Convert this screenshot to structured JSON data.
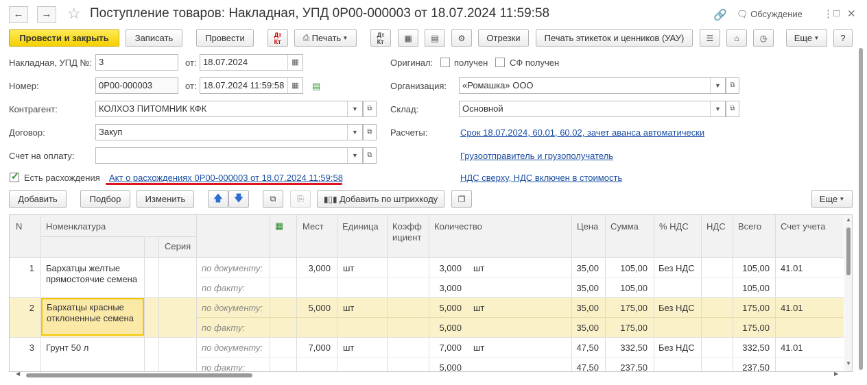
{
  "window": {
    "title": "Поступление товаров: Накладная, УПД 0Р00-000003 от 18.07.2024 11:59:58",
    "discuss_label": "Обсуждение"
  },
  "toolbar": {
    "post_close": "Провести и закрыть",
    "save": "Записать",
    "post": "Провести",
    "print": "Печать",
    "segments": "Отрезки",
    "print_labels": "Печать этикеток и ценников (УАУ)",
    "more": "Еще",
    "help": "?"
  },
  "form": {
    "invoice_label": "Накладная, УПД №:",
    "invoice_value": "3",
    "from_label": "от:",
    "invoice_date": "18.07.2024",
    "number_label": "Номер:",
    "number_value": "0Р00-000003",
    "number_from_label": "от:",
    "number_date": "18.07.2024 11:59:58",
    "counterparty_label": "Контрагент:",
    "counterparty_value": "КОЛХОЗ ПИТОМНИК КФК",
    "contract_label": "Договор:",
    "contract_value": "Закуп",
    "payment_invoice_label": "Счет на оплату:",
    "payment_invoice_value": "",
    "original_label": "Оригинал:",
    "received_label": "получен",
    "sf_received_label": "СФ получен",
    "organization_label": "Организация:",
    "organization_value": "«Ромашка» ООО",
    "warehouse_label": "Склад:",
    "warehouse_value": "Основной",
    "settlements_label": "Расчеты:",
    "settlements_link": "Срок 18.07.2024, 60.01, 60.02, зачет аванса автоматически",
    "shipper_link": "Грузоотправитель и грузополучатель",
    "vat_link": "НДС сверху, НДС включен в стоимость",
    "discrepancy_label": "Есть расхождения",
    "discrepancy_link": "Акт о расхождениях 0Р00-000003 от 18.07.2024 11:59:58"
  },
  "table_toolbar": {
    "add": "Добавить",
    "select": "Подбор",
    "change": "Изменить",
    "add_barcode": "Добавить по штрихкоду",
    "more": "Еще"
  },
  "table": {
    "headers": {
      "n": "N",
      "nomenclature": "Номенклатура",
      "series": "Серия",
      "places": "Мест",
      "unit": "Единица",
      "coef": "Коэфф ициент",
      "quantity": "Количество",
      "price": "Цена",
      "sum": "Сумма",
      "vat_rate": "% НДС",
      "vat": "НДС",
      "total": "Всего",
      "account": "Счет учета"
    },
    "doc_label": "по документу:",
    "fact_label": "по факту:",
    "rows": [
      {
        "n": "1",
        "name": "Бархатцы желтые прямостоячие семена",
        "places": "3,000",
        "unit": "шт",
        "qty_doc": "3,000",
        "qty_unit": "шт",
        "qty_fact": "3,000",
        "price_doc": "35,00",
        "price_fact": "35,00",
        "sum_doc": "105,00",
        "sum_fact": "105,00",
        "vat_rate": "Без НДС",
        "total_doc": "105,00",
        "total_fact": "105,00",
        "account": "41.01"
      },
      {
        "n": "2",
        "name": "Бархатцы красные отклоненные семена",
        "places": "5,000",
        "unit": "шт",
        "qty_doc": "5,000",
        "qty_unit": "шт",
        "qty_fact": "5,000",
        "price_doc": "35,00",
        "price_fact": "35,00",
        "sum_doc": "175,00",
        "sum_fact": "175,00",
        "vat_rate": "Без НДС",
        "total_doc": "175,00",
        "total_fact": "175,00",
        "account": "41.01"
      },
      {
        "n": "3",
        "name": "Грунт 50 л",
        "places": "7,000",
        "unit": "шт",
        "qty_doc": "7,000",
        "qty_unit": "шт",
        "qty_fact": "5,000",
        "price_doc": "47,50",
        "price_fact": "47,50",
        "sum_doc": "332,50",
        "sum_fact": "237,50",
        "vat_rate": "Без НДС",
        "total_doc": "332,50",
        "total_fact": "237,50",
        "account": "41.01"
      }
    ]
  },
  "colors": {
    "primary_button": "#f5d000",
    "link": "#1a4fa3",
    "selected_row": "#fbf1c8",
    "annotation_underline": "#e0141e"
  },
  "icons": [
    "back-arrow-icon",
    "forward-arrow-icon",
    "star-icon",
    "link-icon",
    "discuss-icon",
    "more-vert-icon",
    "maximize-icon",
    "close-icon"
  ]
}
